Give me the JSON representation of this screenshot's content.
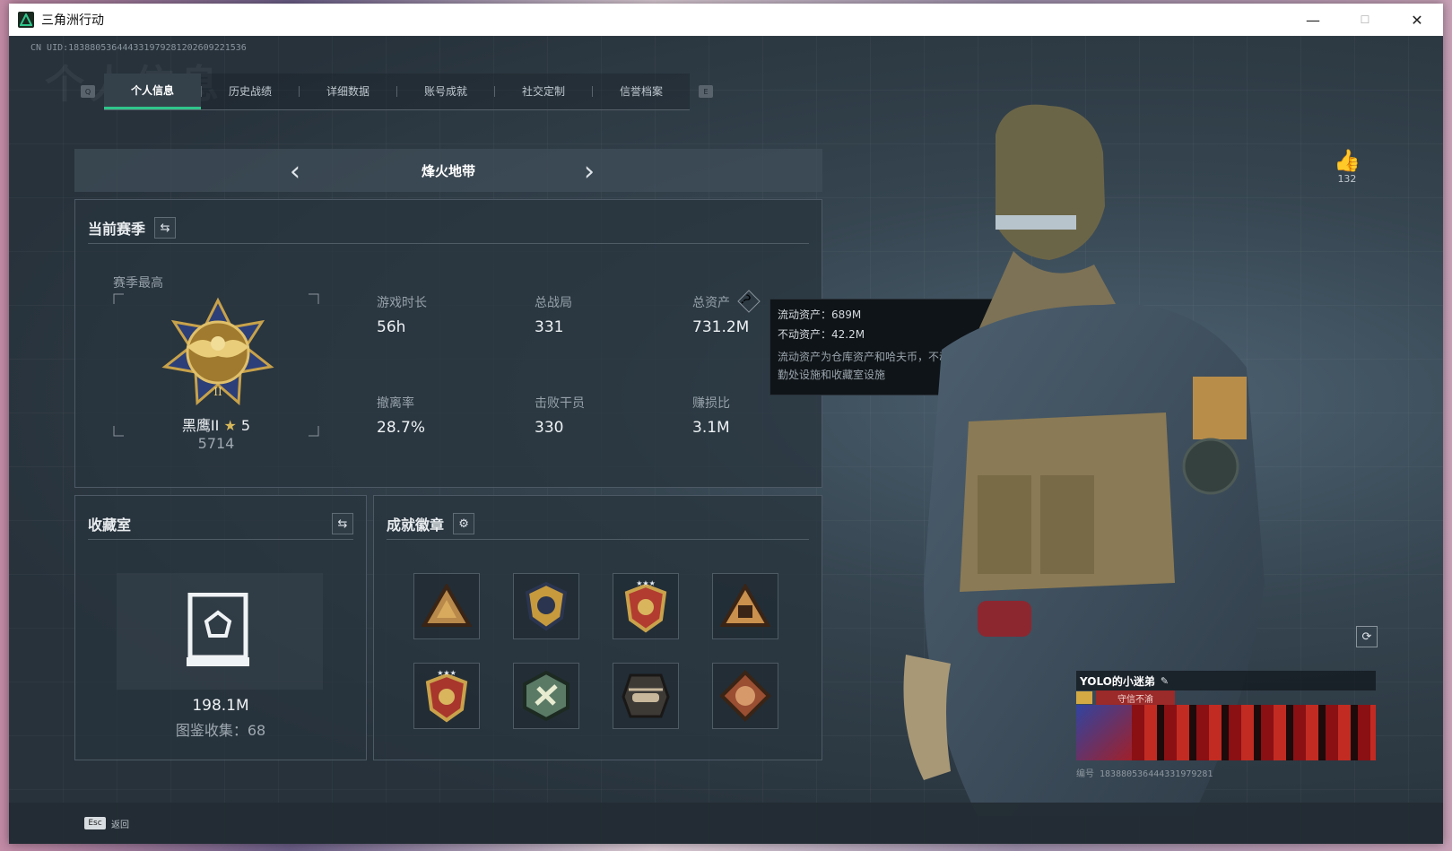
{
  "window": {
    "title": "三角洲行动",
    "minimize": "—",
    "maximize": "☐",
    "close": "✕"
  },
  "header": {
    "uid": "CN UID:1838805364443319792812026092215​36",
    "watermark": "个人信息",
    "key_left": "Q",
    "key_right": "E"
  },
  "tabs": [
    {
      "label": "个人信息",
      "active": true
    },
    {
      "label": "历史战绩"
    },
    {
      "label": "详细数据"
    },
    {
      "label": "账号成就"
    },
    {
      "label": "社交定制"
    },
    {
      "label": "信誉档案"
    }
  ],
  "mode": {
    "title": "烽火地带",
    "prev": "‹",
    "next": "›"
  },
  "season": {
    "title": "当前赛季",
    "swap_icon": "⇆",
    "best_label": "赛季最高",
    "rank_name": "黑鹰II",
    "rank_stars": "5",
    "rank_points": "5714",
    "stats": [
      {
        "label": "游戏时长",
        "value": "56h"
      },
      {
        "label": "总战局",
        "value": "331"
      },
      {
        "label": "总资产",
        "value": "731.2M"
      },
      {
        "label": "撤离率",
        "value": "28.7%"
      },
      {
        "label": "击败干员",
        "value": "330"
      },
      {
        "label": "赚损比",
        "value": "3.1M"
      }
    ],
    "help_icon": "?"
  },
  "tooltip": {
    "liquid": "流动资产：689M",
    "fixed": "不动资产：42.2M",
    "desc": "流动资产为仓库资产和哈夫币，不动资产为特勤处设施和收藏室设施"
  },
  "collection": {
    "title": "收藏室",
    "swap_icon": "⇆",
    "value": "198.1M",
    "count": "图鉴收集：68"
  },
  "achievements": {
    "title": "成就徽章",
    "gear_icon": "⚙"
  },
  "social": {
    "likes": "132"
  },
  "player": {
    "name": "YOLO的小迷弟",
    "tag": "守信不渝",
    "id": "编号 18388053644433197928​1"
  },
  "footer": {
    "esc": "Esc",
    "back": "返回"
  },
  "colors": {
    "accent": "#2fc58b",
    "gold": "#c8a24a",
    "tag_red": "#9b2a2a"
  }
}
